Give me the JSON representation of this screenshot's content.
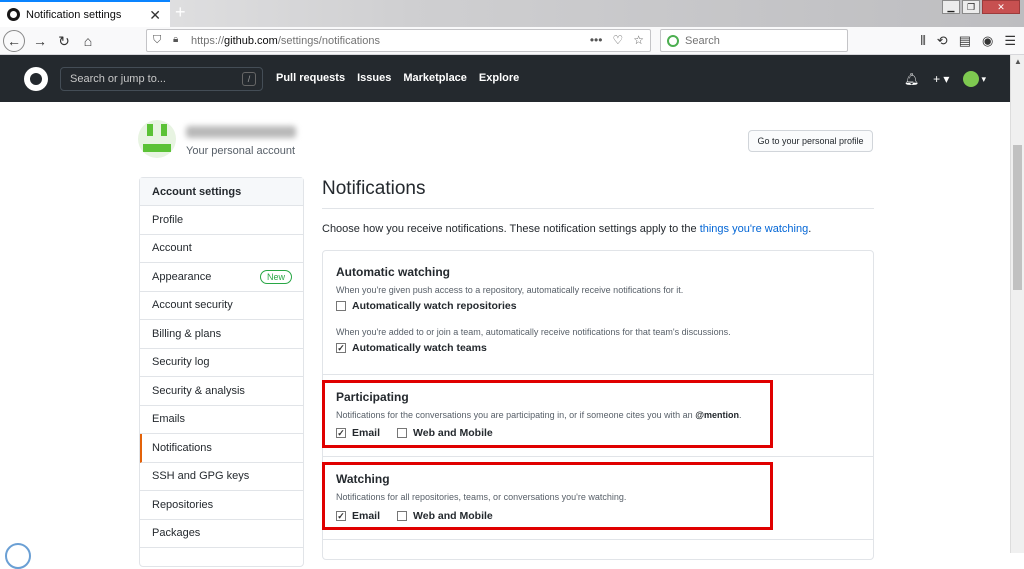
{
  "browser": {
    "tab_title": "Notification settings",
    "url_scheme": "https://",
    "url_host": "github.com",
    "url_path": "/settings/notifications",
    "search_placeholder": "Search",
    "url_more": "•••"
  },
  "github": {
    "search_placeholder": "Search or jump to...",
    "search_shortcut": "/",
    "nav": [
      "Pull requests",
      "Issues",
      "Marketplace",
      "Explore"
    ],
    "plus": "+ ▾",
    "avatar_caret": "▾"
  },
  "profile": {
    "username": "coffeelakestory",
    "subtitle": "Your personal account",
    "profile_button": "Go to your personal profile"
  },
  "menu": {
    "header": "Account settings",
    "items": [
      {
        "label": "Profile"
      },
      {
        "label": "Account"
      },
      {
        "label": "Appearance",
        "badge": "New"
      },
      {
        "label": "Account security"
      },
      {
        "label": "Billing & plans"
      },
      {
        "label": "Security log"
      },
      {
        "label": "Security & analysis"
      },
      {
        "label": "Emails"
      },
      {
        "label": "Notifications",
        "selected": true
      },
      {
        "label": "SSH and GPG keys"
      },
      {
        "label": "Repositories"
      },
      {
        "label": "Packages"
      }
    ]
  },
  "main": {
    "title": "Notifications",
    "description": "Choose how you receive notifications. These notification settings apply to the ",
    "description_link": "things you're watching",
    "description_end": ".",
    "auto": {
      "title": "Automatic watching",
      "desc1": "When you're given push access to a repository, automatically receive notifications for it.",
      "check1": "Automatically watch repositories",
      "check1_checked": false,
      "desc2": "When you're added to or join a team, automatically receive notifications for that team's discussions.",
      "check2": "Automatically watch teams",
      "check2_checked": true
    },
    "participating": {
      "title": "Participating",
      "desc": "Notifications for the conversations you are participating in, or if someone cites you with an ",
      "mention": "@mention",
      "desc_end": ".",
      "email": "Email",
      "email_checked": true,
      "web": "Web and Mobile",
      "web_checked": false
    },
    "watching": {
      "title": "Watching",
      "desc": "Notifications for all repositories, teams, or conversations you're watching.",
      "email": "Email",
      "email_checked": true,
      "web": "Web and Mobile",
      "web_checked": false
    }
  },
  "colors": {
    "highlight": "#e00000",
    "github_header": "#24292e",
    "link": "#0366d6"
  }
}
